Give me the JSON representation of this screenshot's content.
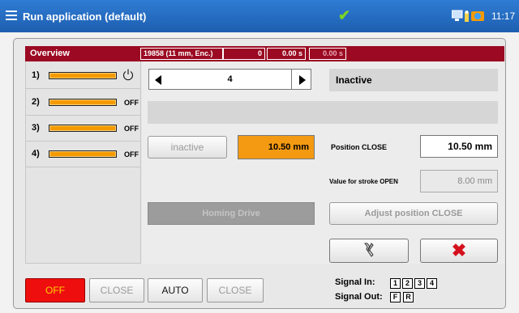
{
  "titlebar": {
    "menu_icon": "hamburger-menu-icon",
    "title": "Run application (default)",
    "status_icon": "checkmark-icon",
    "status_color": "#7ed321",
    "time": "11:17"
  },
  "overview": {
    "title": "Overview",
    "encoder": "19858 (11 mm, Enc.)",
    "counter": "0",
    "time1": "0.00 s",
    "time2": "0.00 s",
    "header_color": "#9b0a22"
  },
  "drives": [
    {
      "label": "1)",
      "state": "",
      "state_icon": "power-icon"
    },
    {
      "label": "2)",
      "state": "OFF"
    },
    {
      "label": "3)",
      "state": "OFF"
    },
    {
      "label": "4)",
      "state": "OFF"
    }
  ],
  "main": {
    "drive_number": "4",
    "status": "Inactive",
    "inactive_button": "inactive",
    "current_position": "10.50 mm",
    "position_close_label": "Position CLOSE",
    "position_close_value": "10.50 mm",
    "stroke_open_label": "Value for stroke OPEN",
    "stroke_open_value": "8.00 mm",
    "homing_button": "Homing Drive",
    "adjust_button": "Adjust position CLOSE",
    "tool_icon": "wrench-icon",
    "cancel_icon": "red-x-icon"
  },
  "modes": {
    "off": "OFF",
    "close1": "CLOSE",
    "auto": "AUTO",
    "close2": "CLOSE",
    "off_color": "#ee0e0e"
  },
  "signals": {
    "in_label": "Signal In:",
    "in_values": [
      "1",
      "2",
      "3",
      "4"
    ],
    "out_label": "Signal Out:",
    "out_values": [
      "F",
      "R"
    ]
  }
}
